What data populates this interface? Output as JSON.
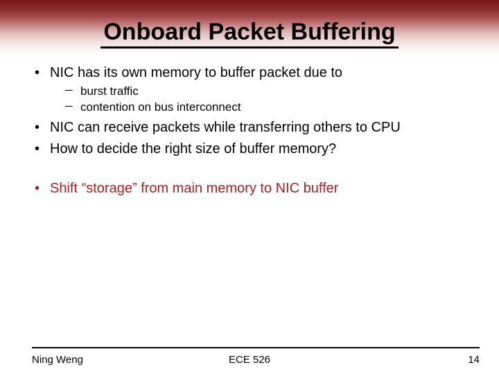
{
  "title": "Onboard Packet Buffering",
  "bullets": {
    "b1": "NIC has its own memory to buffer packet due to",
    "b1_sub": {
      "s1": "burst traffic",
      "s2": "contention on bus interconnect"
    },
    "b2": "NIC can receive packets while transferring others to CPU",
    "b3": "How to decide the right size of buffer memory?",
    "b4": "Shift “storage” from main memory to NIC buffer"
  },
  "footer": {
    "author": "Ning Weng",
    "course": "ECE 526",
    "page": "14"
  }
}
